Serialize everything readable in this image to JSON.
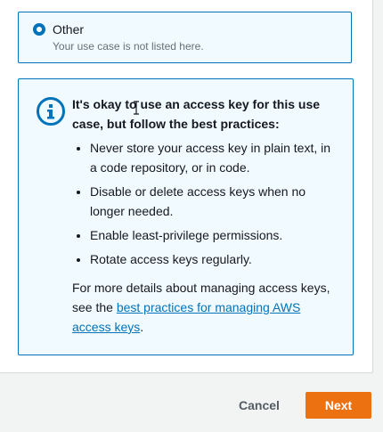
{
  "use_case_option": {
    "label": "Other",
    "description": "Your use case is not listed here.",
    "selected": true
  },
  "info_box": {
    "icon": "info-icon",
    "title": "It's okay to use an access key for this use case, but follow the best practices:",
    "tips": [
      "Never store your access key in plain text, in a code repository, or in code.",
      "Disable or delete access keys when no longer needed.",
      "Enable least-privilege permissions.",
      "Rotate access keys regularly."
    ],
    "details_prefix": "For more details about managing access keys, see the ",
    "details_link": "best practices for managing AWS access keys",
    "details_suffix": "."
  },
  "footer": {
    "cancel_label": "Cancel",
    "next_label": "Next"
  },
  "colors": {
    "accent": "#0073bb",
    "primary_button": "#ec7211",
    "selected_bg": "#f1faff"
  }
}
